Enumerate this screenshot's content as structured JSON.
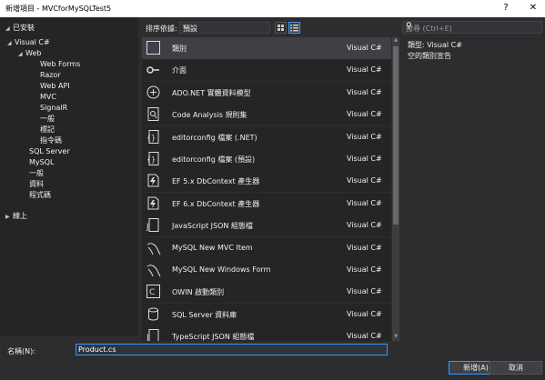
{
  "window": {
    "title": "新增項目 - MVCforMySQLTest5",
    "help_glyph": "?",
    "close_glyph": "✕"
  },
  "left": {
    "installed_label": "已安裝",
    "tree": [
      {
        "label": "Visual C#",
        "expanded": true
      },
      {
        "label": "Web",
        "expanded": true
      },
      {
        "label": "Web Forms"
      },
      {
        "label": "Razor"
      },
      {
        "label": "Web API"
      },
      {
        "label": "MVC"
      },
      {
        "label": "SignalR"
      },
      {
        "label": "一般"
      },
      {
        "label": "標記"
      },
      {
        "label": "指令碼"
      },
      {
        "label": "SQL Server"
      },
      {
        "label": "MySQL"
      },
      {
        "label": "一般"
      },
      {
        "label": "資料"
      },
      {
        "label": "程式碼"
      }
    ],
    "online_label": "線上"
  },
  "toolbar": {
    "sort_label": "排序依據:",
    "sort_value": "預設",
    "search_placeholder": "搜尋 (Ctrl+E)"
  },
  "templates": [
    {
      "name": "類別",
      "lang": "Visual C#",
      "icon": "class-icon"
    },
    {
      "name": "介面",
      "lang": "Visual C#",
      "icon": "interface-icon"
    },
    {
      "name": "ADO.NET 實體資料模型",
      "lang": "Visual C#",
      "icon": "entity-model-icon"
    },
    {
      "name": "Code Analysis 規則集",
      "lang": "Visual C#",
      "icon": "code-analysis-icon"
    },
    {
      "name": "editorconfig 檔案 (.NET)",
      "lang": "Visual C#",
      "icon": "editorconfig-icon"
    },
    {
      "name": "editorconfig 檔案 (預設)",
      "lang": "Visual C#",
      "icon": "editorconfig-icon"
    },
    {
      "name": "EF 5.x DbContext 產生器",
      "lang": "Visual C#",
      "icon": "dbcontext-icon"
    },
    {
      "name": "EF 6.x DbContext 產生器",
      "lang": "Visual C#",
      "icon": "dbcontext-icon"
    },
    {
      "name": "JavaScript JSON 組態檔",
      "lang": "Visual C#",
      "icon": "json-icon"
    },
    {
      "name": "MySQL New MVC Item",
      "lang": "Visual C#",
      "icon": "mysql-icon"
    },
    {
      "name": "MySQL New Windows Form",
      "lang": "Visual C#",
      "icon": "mysql-icon"
    },
    {
      "name": "OWIN 啟動類別",
      "lang": "Visual C#",
      "icon": "owin-icon"
    },
    {
      "name": "SQL Server 資料庫",
      "lang": "Visual C#",
      "icon": "database-icon"
    },
    {
      "name": "TypeScript JSON 組態檔",
      "lang": "Visual C#",
      "icon": "json-icon"
    }
  ],
  "detail": {
    "type_line": "類型: Visual C#",
    "description": "空的類別宣告"
  },
  "bottom": {
    "name_label": "名稱(N):",
    "name_value": "Product.cs",
    "add_label": "新增(A)",
    "cancel_label": "取消"
  },
  "colors": {
    "accent": "#3399ff",
    "background": "#2d2d30",
    "pane": "#252526",
    "selected": "#3f3f46"
  }
}
